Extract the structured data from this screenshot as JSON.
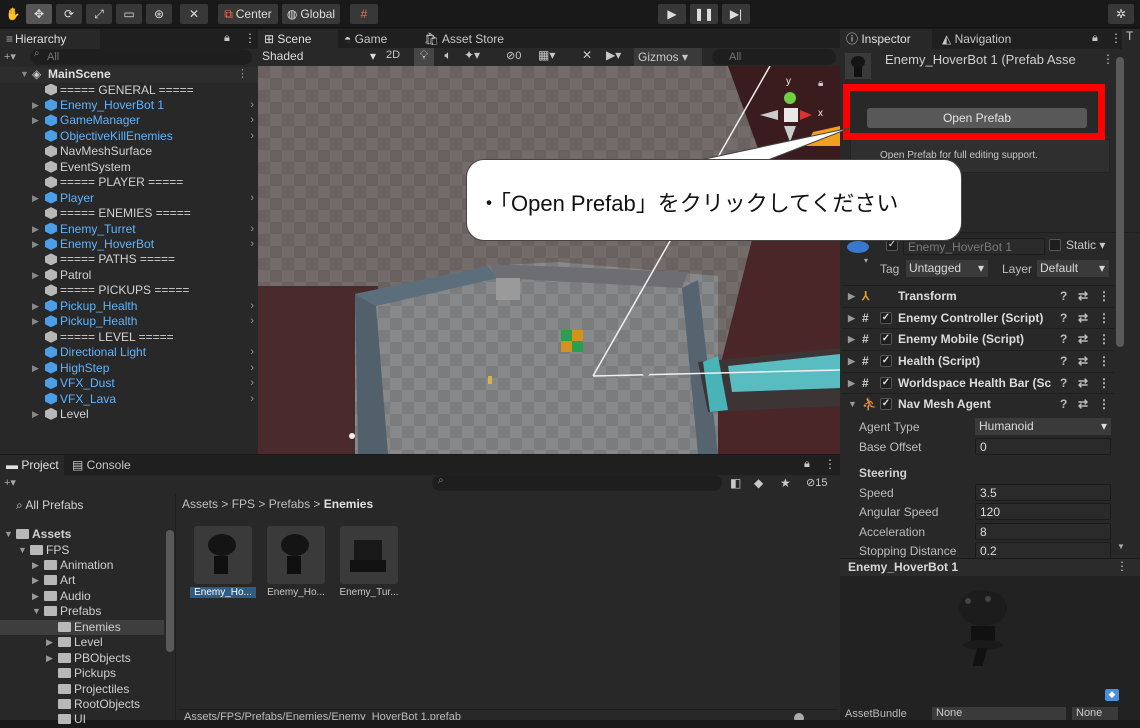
{
  "toolbar": {
    "center_label": "Center",
    "global_label": "Global"
  },
  "hierarchy": {
    "tab": "Hierarchy",
    "search_placeholder": "All",
    "scene": "MainScene",
    "items": [
      {
        "label": "===== GENERAL =====",
        "color": "white",
        "arrow": false,
        "fold": false
      },
      {
        "label": "Enemy_HoverBot 1",
        "color": "blue",
        "arrow": true,
        "fold": true
      },
      {
        "label": "GameManager",
        "color": "blue",
        "arrow": true,
        "fold": true
      },
      {
        "label": "ObjectiveKillEnemies",
        "color": "blue",
        "arrow": true,
        "fold": false
      },
      {
        "label": "NavMeshSurface",
        "color": "white",
        "arrow": false,
        "fold": false
      },
      {
        "label": "EventSystem",
        "color": "white",
        "arrow": false,
        "fold": false
      },
      {
        "label": "===== PLAYER =====",
        "color": "white",
        "arrow": false,
        "fold": false
      },
      {
        "label": "Player",
        "color": "blue",
        "arrow": true,
        "fold": true
      },
      {
        "label": "===== ENEMIES =====",
        "color": "white",
        "arrow": false,
        "fold": false
      },
      {
        "label": "Enemy_Turret",
        "color": "blue",
        "arrow": true,
        "fold": true
      },
      {
        "label": "Enemy_HoverBot",
        "color": "blue",
        "arrow": true,
        "fold": true
      },
      {
        "label": "===== PATHS =====",
        "color": "white",
        "arrow": false,
        "fold": false
      },
      {
        "label": "Patrol",
        "color": "white",
        "arrow": false,
        "fold": true
      },
      {
        "label": "===== PICKUPS =====",
        "color": "white",
        "arrow": false,
        "fold": false
      },
      {
        "label": "Pickup_Health",
        "color": "blue",
        "arrow": true,
        "fold": true
      },
      {
        "label": "Pickup_Health",
        "color": "blue",
        "arrow": true,
        "fold": true
      },
      {
        "label": "===== LEVEL =====",
        "color": "white",
        "arrow": false,
        "fold": false
      },
      {
        "label": "Directional Light",
        "color": "blue",
        "arrow": true,
        "fold": false
      },
      {
        "label": "HighStep",
        "color": "blue",
        "arrow": true,
        "fold": true
      },
      {
        "label": "VFX_Dust",
        "color": "blue",
        "arrow": true,
        "fold": false
      },
      {
        "label": "VFX_Lava",
        "color": "blue",
        "arrow": true,
        "fold": false
      },
      {
        "label": "Level",
        "color": "white",
        "arrow": false,
        "fold": true
      }
    ]
  },
  "scene": {
    "tabs": [
      "Scene",
      "Game",
      "Asset Store"
    ],
    "shading": "Shaded",
    "mode_2d": "2D",
    "hidden_count": "0",
    "gizmos": "Gizmos",
    "search_placeholder": "All",
    "axis_y": "y",
    "axis_x": "x"
  },
  "callout": {
    "text": "・「Open Prefab」をクリックしてください"
  },
  "inspector": {
    "tabs": [
      "Inspector",
      "Navigation"
    ],
    "title": "Enemy_HoverBot 1 (Prefab Asse",
    "open_prefab": "Open Prefab",
    "help_text": "Open Prefab for full editing support.",
    "object_name": "Enemy_HoverBot 1",
    "static_label": "Static",
    "tag_label": "Tag",
    "tag_value": "Untagged",
    "layer_label": "Layer",
    "layer_value": "Default",
    "components": [
      "Transform",
      "Enemy Controller (Script)",
      "Enemy Mobile (Script)",
      "Health (Script)",
      "Worldspace Health Bar (Sc",
      "Nav Mesh Agent"
    ],
    "agent_type_label": "Agent Type",
    "agent_type_value": "Humanoid",
    "base_offset_label": "Base Offset",
    "base_offset_value": "0",
    "steering_label": "Steering",
    "props": [
      {
        "label": "Speed",
        "value": "3.5"
      },
      {
        "label": "Angular Speed",
        "value": "120"
      },
      {
        "label": "Acceleration",
        "value": "8"
      },
      {
        "label": "Stopping Distance",
        "value": "0.2"
      }
    ],
    "preview_title": "Enemy_HoverBot 1",
    "assetbundle_label": "AssetBundle",
    "assetbundle_value": "None",
    "assetbundle_variant": "None"
  },
  "project": {
    "tabs": [
      "Project",
      "Console"
    ],
    "hidden_count": "15",
    "favorites": "All Prefabs",
    "breadcrumb": [
      "Assets",
      "FPS",
      "Prefabs",
      "Enemies"
    ],
    "tree": [
      {
        "label": "Assets",
        "indent": 0,
        "bold": true
      },
      {
        "label": "FPS",
        "indent": 1,
        "bold": false
      },
      {
        "label": "Animation",
        "indent": 2,
        "bold": false
      },
      {
        "label": "Art",
        "indent": 2,
        "bold": false
      },
      {
        "label": "Audio",
        "indent": 2,
        "bold": false
      },
      {
        "label": "Prefabs",
        "indent": 2,
        "bold": false
      },
      {
        "label": "Enemies",
        "indent": 3,
        "bold": false
      },
      {
        "label": "Level",
        "indent": 3,
        "bold": false
      },
      {
        "label": "PBObjects",
        "indent": 3,
        "bold": false
      },
      {
        "label": "Pickups",
        "indent": 3,
        "bold": false
      },
      {
        "label": "Projectiles",
        "indent": 3,
        "bold": false
      },
      {
        "label": "RootObjects",
        "indent": 3,
        "bold": false
      },
      {
        "label": "UI",
        "indent": 3,
        "bold": false
      }
    ],
    "assets": [
      "Enemy_Ho...",
      "Enemy_Ho...",
      "Enemy_Tur..."
    ],
    "status_path": "Assets/FPS/Prefabs/Enemies/Enemy_HoverBot 1.prefab"
  },
  "colors": {
    "highlight_red": "#ff0000",
    "selection_blue": "#2c5d87",
    "prefab_blue": "#5fb4ff"
  }
}
